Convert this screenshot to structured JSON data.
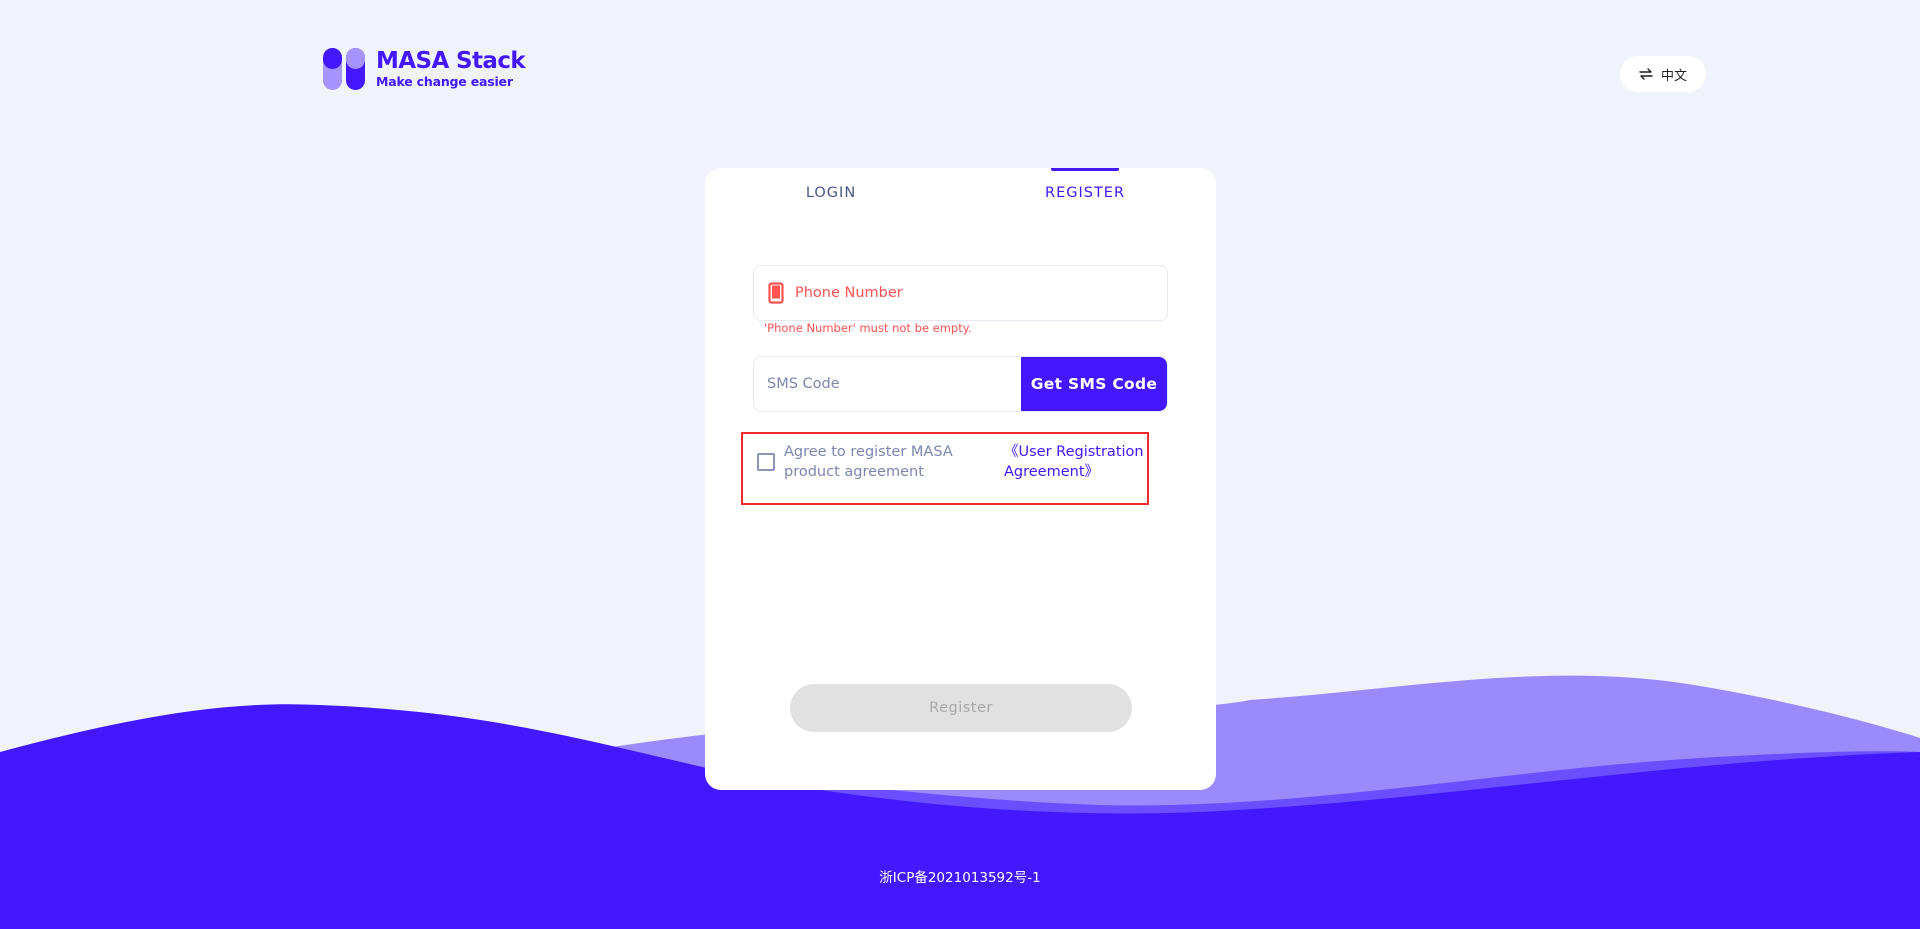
{
  "header": {
    "brand_name": "MASA Stack",
    "brand_tagline": "Make change easier",
    "language_label": "中文"
  },
  "tabs": [
    {
      "label": "LOGIN",
      "active": false
    },
    {
      "label": "REGISTER",
      "active": true
    }
  ],
  "form": {
    "phone": {
      "placeholder": "Phone Number",
      "value": "",
      "error": "'Phone Number' must not be empty."
    },
    "sms": {
      "placeholder": "SMS Code",
      "value": "",
      "button_label": "Get SMS Code"
    },
    "agreement": {
      "checked": false,
      "text": "Agree to register MASA product agreement",
      "link_text": "《User Registration Agreement》"
    },
    "submit_label": "Register"
  },
  "footer": {
    "icp": "浙ICP备2021013592号-1"
  },
  "colors": {
    "primary": "#4318FF",
    "background": "#F0F3FA",
    "error": "#FF5252",
    "wave_light": "#9B8AFB",
    "wave_mid": "#6B4EFF"
  },
  "icons": {
    "logo": "masa-logo-icon",
    "language": "swap-arrows-icon",
    "phone": "smartphone-icon"
  }
}
